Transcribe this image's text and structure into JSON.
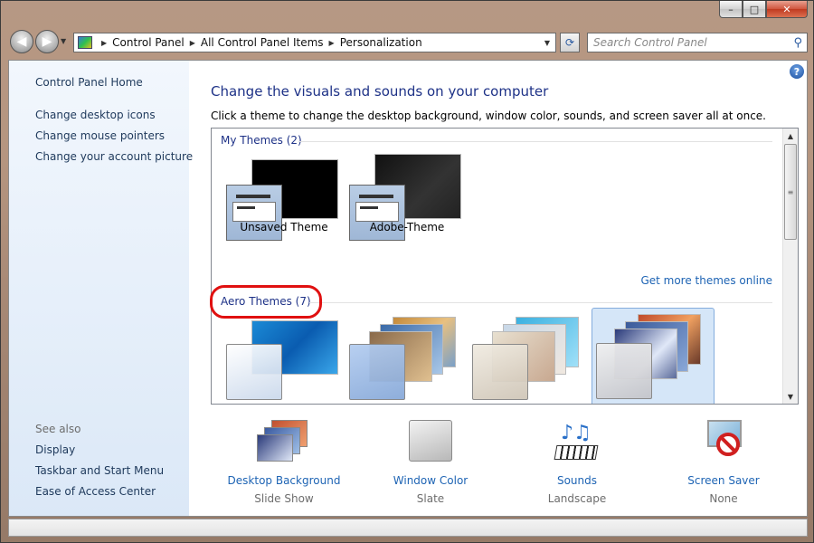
{
  "window": {
    "caption_buttons": {
      "minimize": "–",
      "maximize": "□",
      "close": "✕"
    }
  },
  "nav": {
    "breadcrumbs": [
      "Control Panel",
      "All Control Panel Items",
      "Personalization"
    ],
    "search_placeholder": "Search Control Panel"
  },
  "sidebar": {
    "home": "Control Panel Home",
    "links": [
      "Change desktop icons",
      "Change mouse pointers",
      "Change your account picture"
    ],
    "see_also_label": "See also",
    "see_also": [
      "Display",
      "Taskbar and Start Menu",
      "Ease of Access Center"
    ]
  },
  "main": {
    "title": "Change the visuals and sounds on your computer",
    "subtitle": "Click a theme to change the desktop background, window color, sounds, and screen saver all at once.",
    "my_themes_header": "My Themes (2)",
    "my_themes": [
      {
        "name": "Unsaved Theme",
        "bg_color": "#000000"
      },
      {
        "name": "Adobe-Theme",
        "bg_color": "#1a1a1a"
      }
    ],
    "get_more": "Get more themes online",
    "aero_header": "Aero Themes (7)",
    "aero_themes_visible": 4,
    "selected_aero_index": 3
  },
  "bottom": [
    {
      "label": "Desktop Background",
      "value": "Slide Show",
      "icon": "slideshow-icon"
    },
    {
      "label": "Window Color",
      "value": "Slate",
      "icon": "window-color-icon"
    },
    {
      "label": "Sounds",
      "value": "Landscape",
      "icon": "sounds-icon"
    },
    {
      "label": "Screen Saver",
      "value": "None",
      "icon": "screen-saver-icon"
    }
  ],
  "colors": {
    "link": "#1e64b4",
    "title": "#1e3287",
    "annotation": "#e01010",
    "selection": "#d5e6f8"
  }
}
